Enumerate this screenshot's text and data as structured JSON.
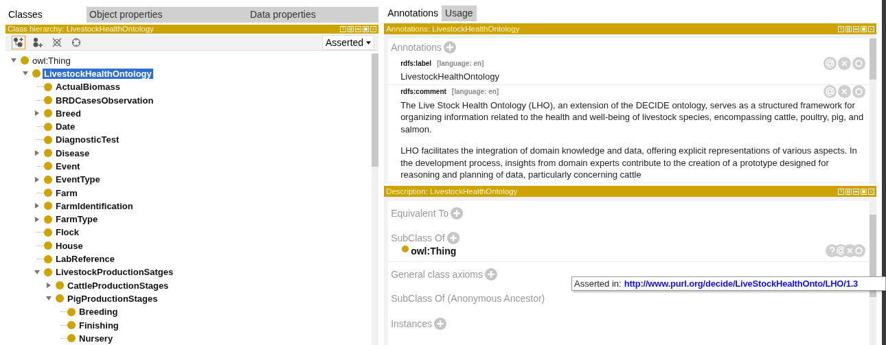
{
  "left_tabs": [
    {
      "label": "Classes",
      "selected": true
    },
    {
      "label": "Object properties",
      "selected": false
    },
    {
      "label": "Data properties",
      "selected": false
    }
  ],
  "class_hierarchy": {
    "title": "Class hierarchy: LivestockHealthOntology",
    "mode": "Asserted",
    "tree": [
      {
        "label": "owl:Thing",
        "selected": false,
        "expanded": true,
        "children": [
          {
            "label": "LivestockHealthOntology",
            "selected": true,
            "expanded": true,
            "children": [
              {
                "label": "ActualBiomass",
                "selected": false
              },
              {
                "label": "BRDCasesObservation",
                "selected": false
              },
              {
                "label": "Breed",
                "selected": false,
                "expanded": false
              },
              {
                "label": "Date",
                "selected": false
              },
              {
                "label": "DiagnosticTest",
                "selected": false
              },
              {
                "label": "Disease",
                "selected": false,
                "expanded": false
              },
              {
                "label": "Event",
                "selected": false
              },
              {
                "label": "EventType",
                "selected": false,
                "expanded": false
              },
              {
                "label": "Farm",
                "selected": false
              },
              {
                "label": "FarmIdentification",
                "selected": false,
                "expanded": false
              },
              {
                "label": "FarmType",
                "selected": false,
                "expanded": false
              },
              {
                "label": "Flock",
                "selected": false
              },
              {
                "label": "House",
                "selected": false
              },
              {
                "label": "LabReference",
                "selected": false
              },
              {
                "label": "LivestockProductionSatges",
                "selected": false,
                "expanded": true,
                "children": [
                  {
                    "label": "CattleProductionStages",
                    "selected": false,
                    "expanded": false
                  },
                  {
                    "label": "PigProductionStages",
                    "selected": false,
                    "expanded": true,
                    "children": [
                      {
                        "label": "Breeding",
                        "selected": false
                      },
                      {
                        "label": "Finishing",
                        "selected": false
                      },
                      {
                        "label": "Nursery",
                        "selected": false
                      }
                    ]
                  }
                ]
              }
            ]
          }
        ]
      }
    ]
  },
  "right_tabs": [
    {
      "label": "Annotations",
      "selected": true
    },
    {
      "label": "Usage",
      "selected": false
    }
  ],
  "annotations_panel": {
    "title": "Annotations: LivestockHealthOntology",
    "heading": "Annotations",
    "items": [
      {
        "property": "rdfs:label",
        "language": "[language: en]",
        "paragraphs": [
          "LivestockHealthOntology"
        ]
      },
      {
        "property": "rdfs:comment",
        "language": "[language: en]",
        "paragraphs": [
          "The Live Stock Health Ontology (LHO), an extension of the DECIDE ontology, serves as a structured framework for organizing information related to the health and well-being of livestock species, encompassing cattle, poultry, pig, and salmon.",
          "LHO facilitates the integration of domain knowledge and data, offering explicit representations of various aspects. In the development process, insights from domain experts contribute to the creation of a prototype designed for reasoning and planning of data, particularly concerning cattle"
        ]
      }
    ]
  },
  "description_panel": {
    "title": "Description: LivestockHealthOntology",
    "sections": [
      {
        "heading": "Equivalent To",
        "addable": true
      },
      {
        "heading": "SubClass Of",
        "addable": true,
        "items": [
          {
            "label": "owl:Thing"
          }
        ]
      },
      {
        "heading": "General class axioms",
        "addable": true
      },
      {
        "heading": "SubClass Of (Anonymous Ancestor)",
        "addable": false
      },
      {
        "heading": "Instances",
        "addable": true
      }
    ]
  },
  "tooltip": {
    "prefix": "Asserted in:",
    "link": "http://www.purl.org/decide/LiveStockHealthOnto/LHO/1.3"
  }
}
